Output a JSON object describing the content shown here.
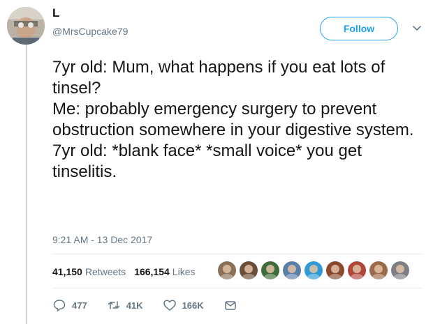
{
  "user": {
    "display_name": "L",
    "handle": "@MrsCupcake79"
  },
  "header": {
    "follow_label": "Follow"
  },
  "tweet": {
    "text": "7yr old: Mum, what happens if you eat lots of tinsel?\nMe: probably emergency surgery to prevent obstruction somewhere in your digestive system.\n7yr old: *blank face* *small voice* you get tinselitis.",
    "timestamp": "9:21 AM - 13 Dec 2017"
  },
  "stats": {
    "retweets_count": "41,150",
    "retweets_label": "Retweets",
    "likes_count": "166,154",
    "likes_label": "Likes"
  },
  "likers": [
    {
      "color": "#8a7058"
    },
    {
      "color": "#6b4e37"
    },
    {
      "color": "#3f6d3a"
    },
    {
      "color": "#5a7fa8"
    },
    {
      "color": "#2f9ad6"
    },
    {
      "color": "#8a4a2e"
    },
    {
      "color": "#b0473c"
    },
    {
      "color": "#9c6a4a"
    },
    {
      "color": "#7d7f85"
    }
  ],
  "actions": {
    "reply_count": "477",
    "retweet_count": "41K",
    "like_count": "166K"
  },
  "colors": {
    "accent": "#1da1f2",
    "muted": "#657786",
    "text": "#14171a"
  }
}
